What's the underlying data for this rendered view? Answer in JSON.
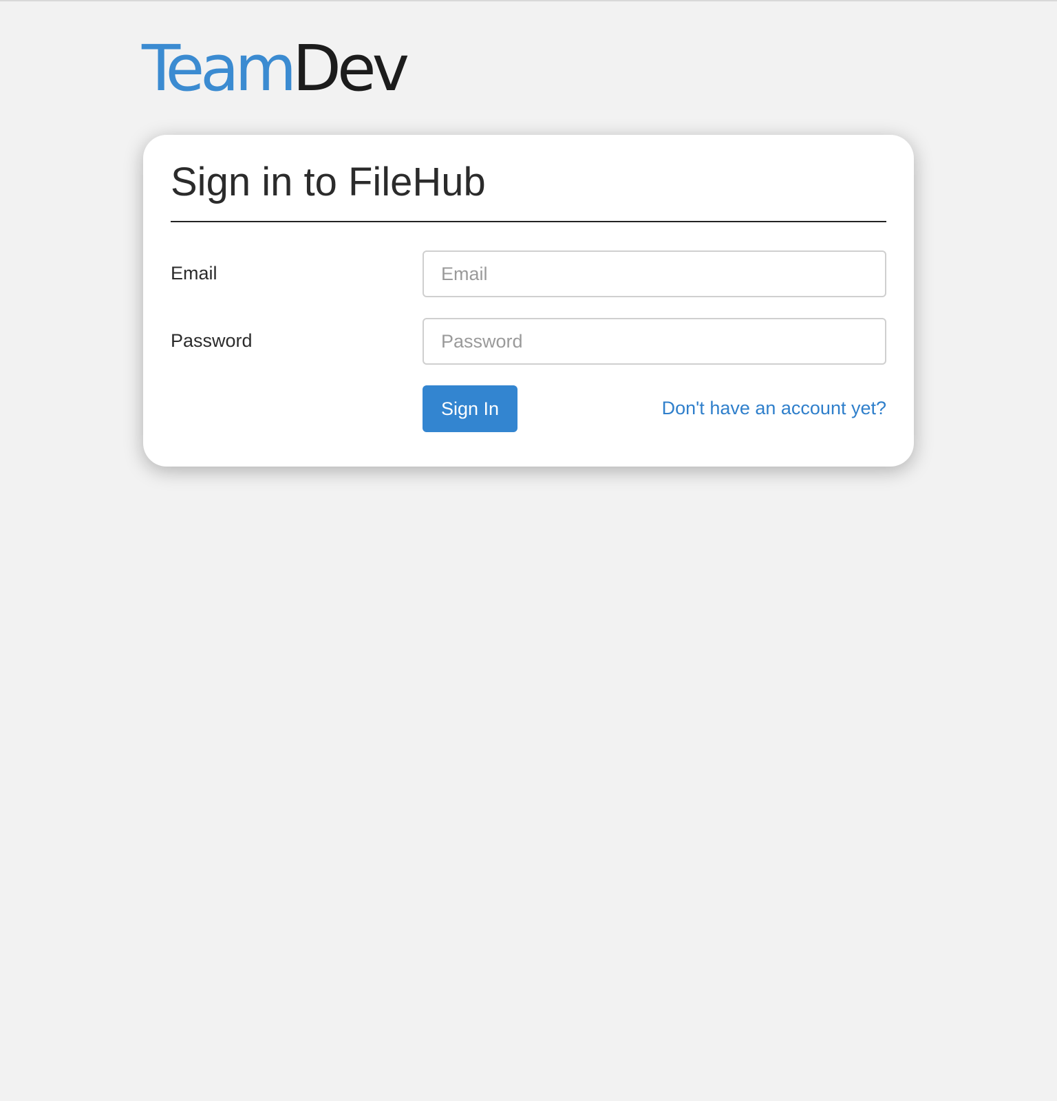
{
  "logo": {
    "part_a": "Team",
    "part_b": "Dev",
    "colors": {
      "team": "#3b8bd1",
      "dev": "#1c1c1c"
    }
  },
  "card": {
    "title": "Sign in to FileHub"
  },
  "form": {
    "email": {
      "label": "Email",
      "placeholder": "Email",
      "value": ""
    },
    "password": {
      "label": "Password",
      "placeholder": "Password",
      "value": ""
    },
    "submit_label": "Sign In",
    "register_link": "Don't have an account yet?"
  },
  "colors": {
    "accent": "#3385d0",
    "link": "#2f7fcb",
    "page_background": "#f2f2f2",
    "card_background": "#ffffff"
  }
}
